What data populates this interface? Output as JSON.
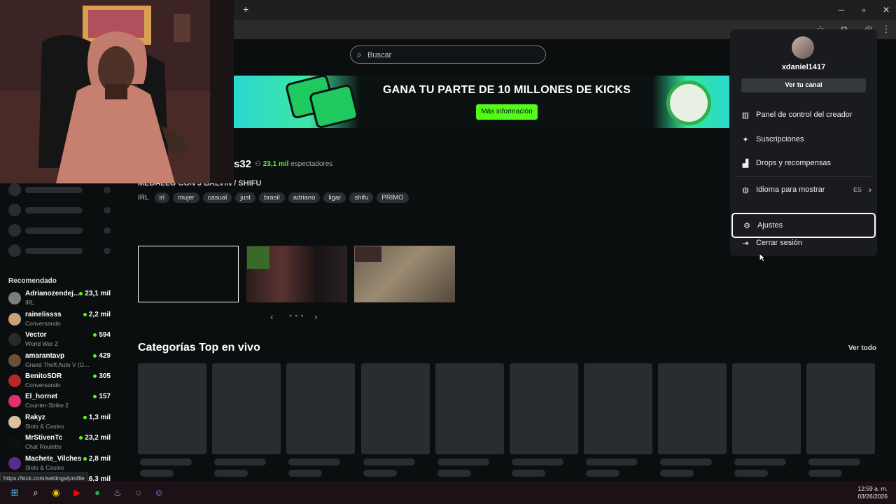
{
  "browser": {
    "new_tab": "+",
    "window": {
      "minimize": "─",
      "maximize": "▫",
      "close": "✕"
    }
  },
  "search": {
    "placeholder": "Buscar"
  },
  "banner": {
    "title": "GANA TU PARTE DE 10 MILLONES DE KICKS",
    "button": "Más información"
  },
  "stream": {
    "channel_fragment": "s32",
    "viewers_count": "23,1 mil",
    "viewers_label": "espectadores",
    "title": "MEDALLO CON J BALVIN / SHIFU",
    "category": "IRL",
    "tags": [
      "irl",
      "mujer",
      "casual",
      "just",
      "brasil",
      "adriano",
      "ligar",
      "shifu",
      "PRIMO"
    ]
  },
  "carousel": {
    "prev": "‹",
    "next": "›",
    "dots": "● ● ●"
  },
  "categories": {
    "title": "Categorías Top en vivo",
    "see_all": "Ver todo"
  },
  "sidebar": {
    "recommended_title": "Recomendado",
    "recommended": [
      {
        "name": "Adrianozendej...",
        "game": "IRL",
        "viewers": "23,1 mil"
      },
      {
        "name": "rainelissss",
        "game": "Conversando",
        "viewers": "2,2 mil"
      },
      {
        "name": "Vector",
        "game": "World War Z",
        "viewers": "594"
      },
      {
        "name": "amarantavp",
        "game": "Grand Theft Auto V (G...",
        "viewers": "429"
      },
      {
        "name": "BenitoSDR",
        "game": "Conversando",
        "viewers": "305"
      },
      {
        "name": "El_hornet",
        "game": "Counter-Strike 2",
        "viewers": "157"
      },
      {
        "name": "Rakyz",
        "game": "Slots & Casino",
        "viewers": "1,3 mil"
      },
      {
        "name": "MrStivenTc",
        "game": "Chat Roulette",
        "viewers": "23,2 mil"
      },
      {
        "name": "Machete_Vilches",
        "game": "Slots & Casino",
        "viewers": "2,8 mil"
      },
      {
        "name": "",
        "game": "",
        "viewers": "16,3 mil"
      }
    ]
  },
  "user_menu": {
    "username": "xdaniel1417",
    "channel_button": "Ver tu canal",
    "items": [
      {
        "label": "Panel de control del creador",
        "icon": "chart-icon"
      },
      {
        "label": "Suscripciones",
        "icon": "sparkle-icon"
      },
      {
        "label": "Drops y recompensas",
        "icon": "gift-icon"
      },
      {
        "label": "Idioma para mostrar",
        "icon": "globe-icon",
        "value": "ES"
      },
      {
        "label": "Ajustes",
        "icon": "gear-icon"
      },
      {
        "label": "Cerrar sesión",
        "icon": "logout-icon"
      }
    ]
  },
  "status_url": "https://kick.com/settings/profile",
  "taskbar": {
    "time": "12:59 a. m.",
    "date": "03/26/2026"
  },
  "colors": {
    "accent": "#53fc18",
    "background": "#0b0e0f",
    "menu_bg": "#191b1f"
  }
}
